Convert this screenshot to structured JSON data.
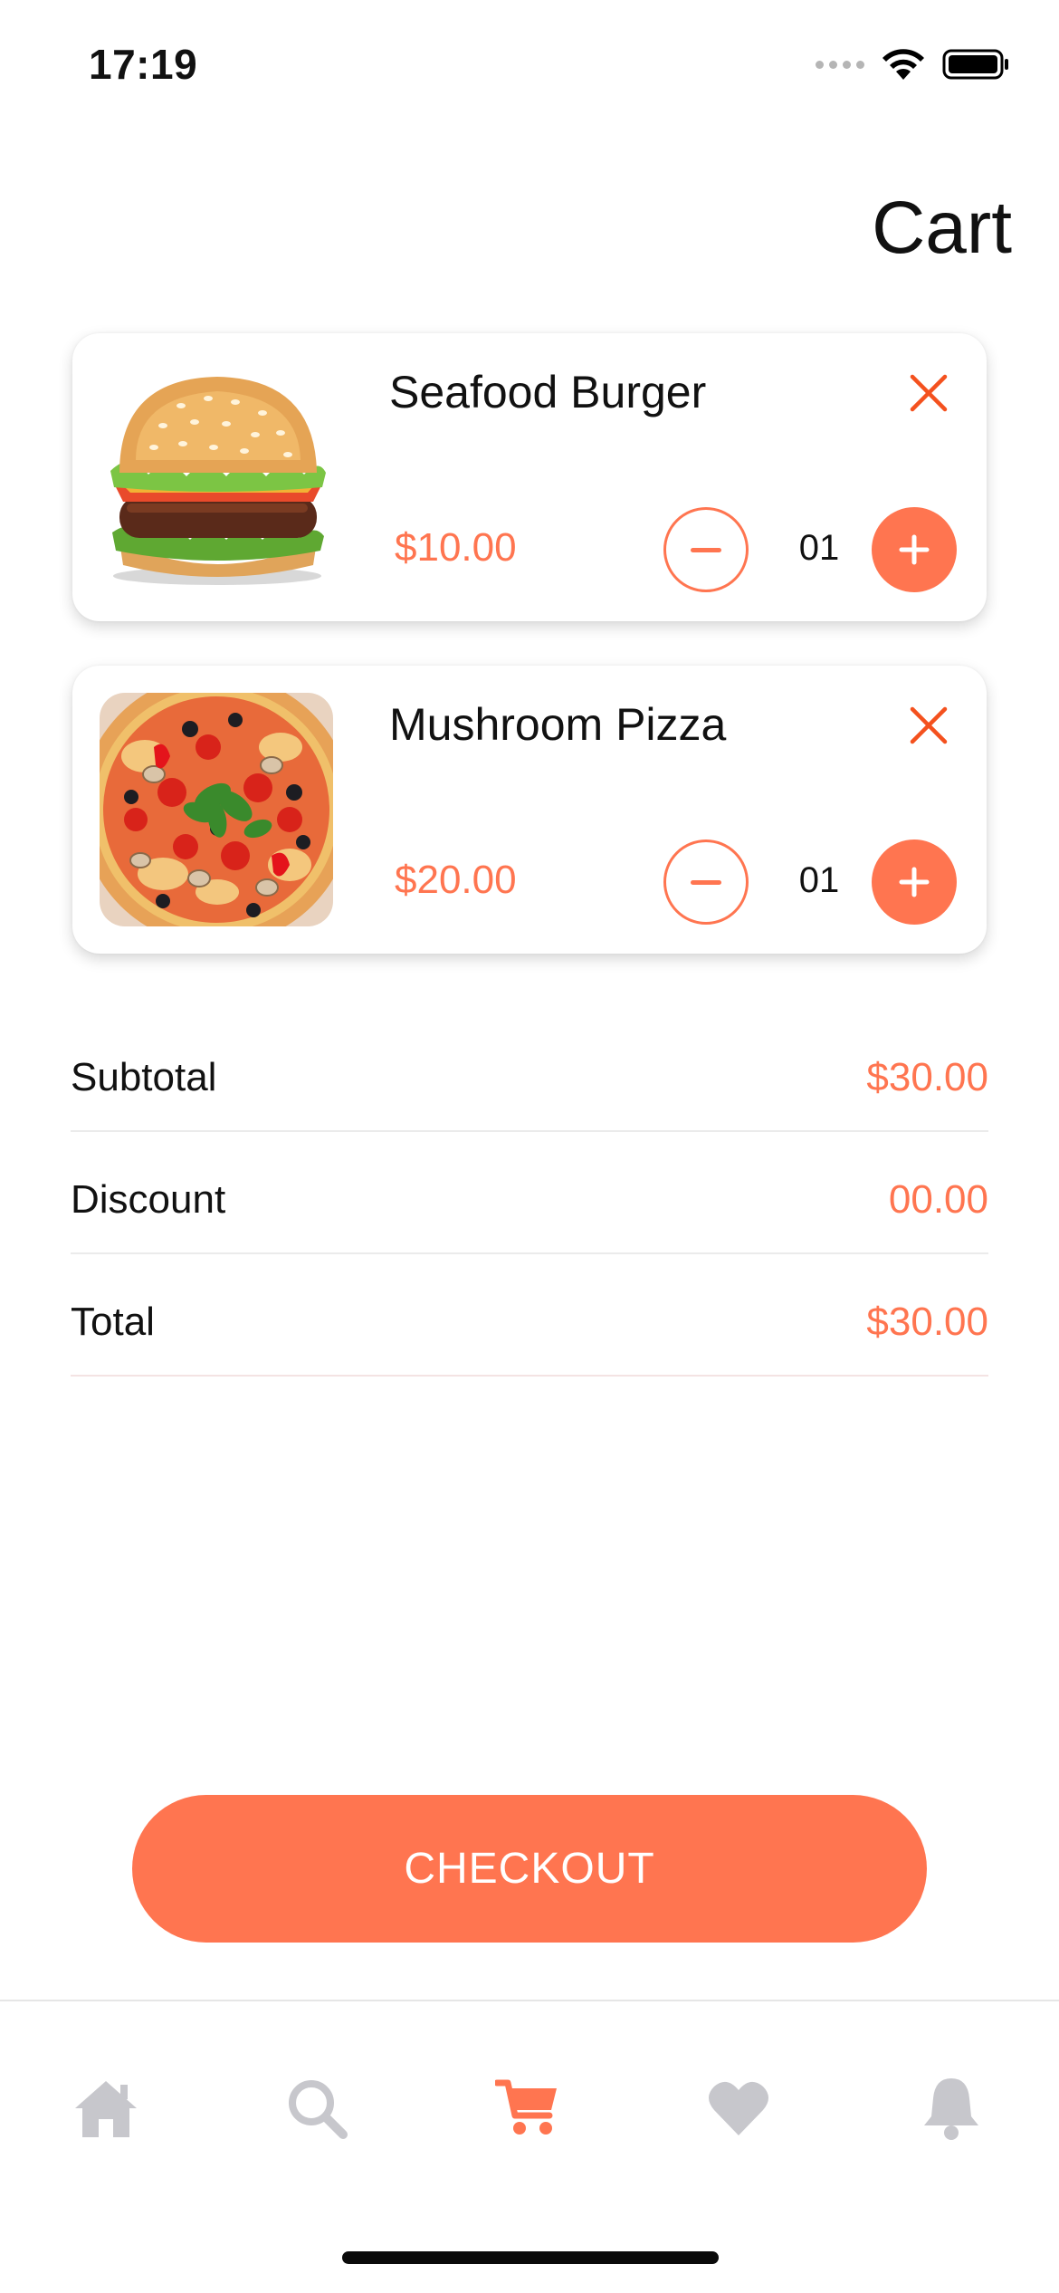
{
  "status_bar": {
    "time": "17:19",
    "icons": [
      "cellular-icon",
      "wifi-icon",
      "battery-icon"
    ]
  },
  "page": {
    "title": "Cart"
  },
  "cart": {
    "items": [
      {
        "name": "Seafood Burger",
        "price": "$10.00",
        "quantity": "01",
        "image": "burger-image"
      },
      {
        "name": "Mushroom Pizza",
        "price": "$20.00",
        "quantity": "01",
        "image": "pizza-image"
      }
    ]
  },
  "summary": {
    "rows": [
      {
        "label": "Subtotal",
        "value": "$30.00"
      },
      {
        "label": "Discount",
        "value": "00.00"
      },
      {
        "label": "Total",
        "value": "$30.00"
      }
    ]
  },
  "checkout": {
    "label": "CHECKOUT"
  },
  "tab_bar": {
    "active": "cart",
    "tabs": [
      "home-icon",
      "search-icon",
      "cart-icon",
      "heart-icon",
      "bell-icon"
    ]
  },
  "colors": {
    "accent": "#ff7550",
    "inactive_icon": "#c7c7cc",
    "text": "#111111"
  }
}
